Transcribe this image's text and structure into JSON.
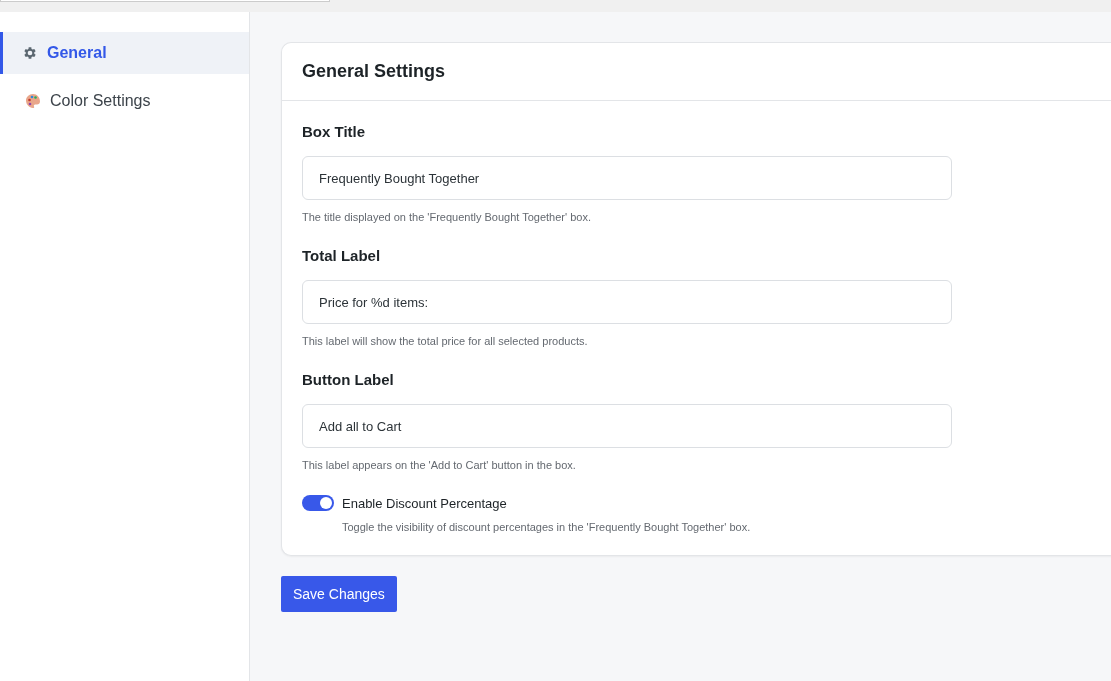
{
  "sidebar": {
    "items": [
      {
        "label": "General",
        "kind": "general",
        "selected": true
      },
      {
        "label": "Color Settings",
        "kind": "colors",
        "selected": false
      }
    ]
  },
  "card": {
    "title": "General Settings",
    "fields": [
      {
        "label": "Box Title",
        "value": "Frequently Bought Together",
        "help": "The title displayed on the 'Frequently Bought Together' box."
      },
      {
        "label": "Total Label",
        "value": "Price for %d items:",
        "help": "This label will show the total price for all selected products."
      },
      {
        "label": "Button Label",
        "value": "Add all to Cart",
        "help": "This label appears on the 'Add to Cart' button in the box."
      }
    ],
    "toggle": {
      "label": "Enable Discount Percentage",
      "on": true,
      "help": "Toggle the visibility of discount percentages in the 'Frequently Bought Together' box."
    }
  },
  "save_button": "Save Changes"
}
